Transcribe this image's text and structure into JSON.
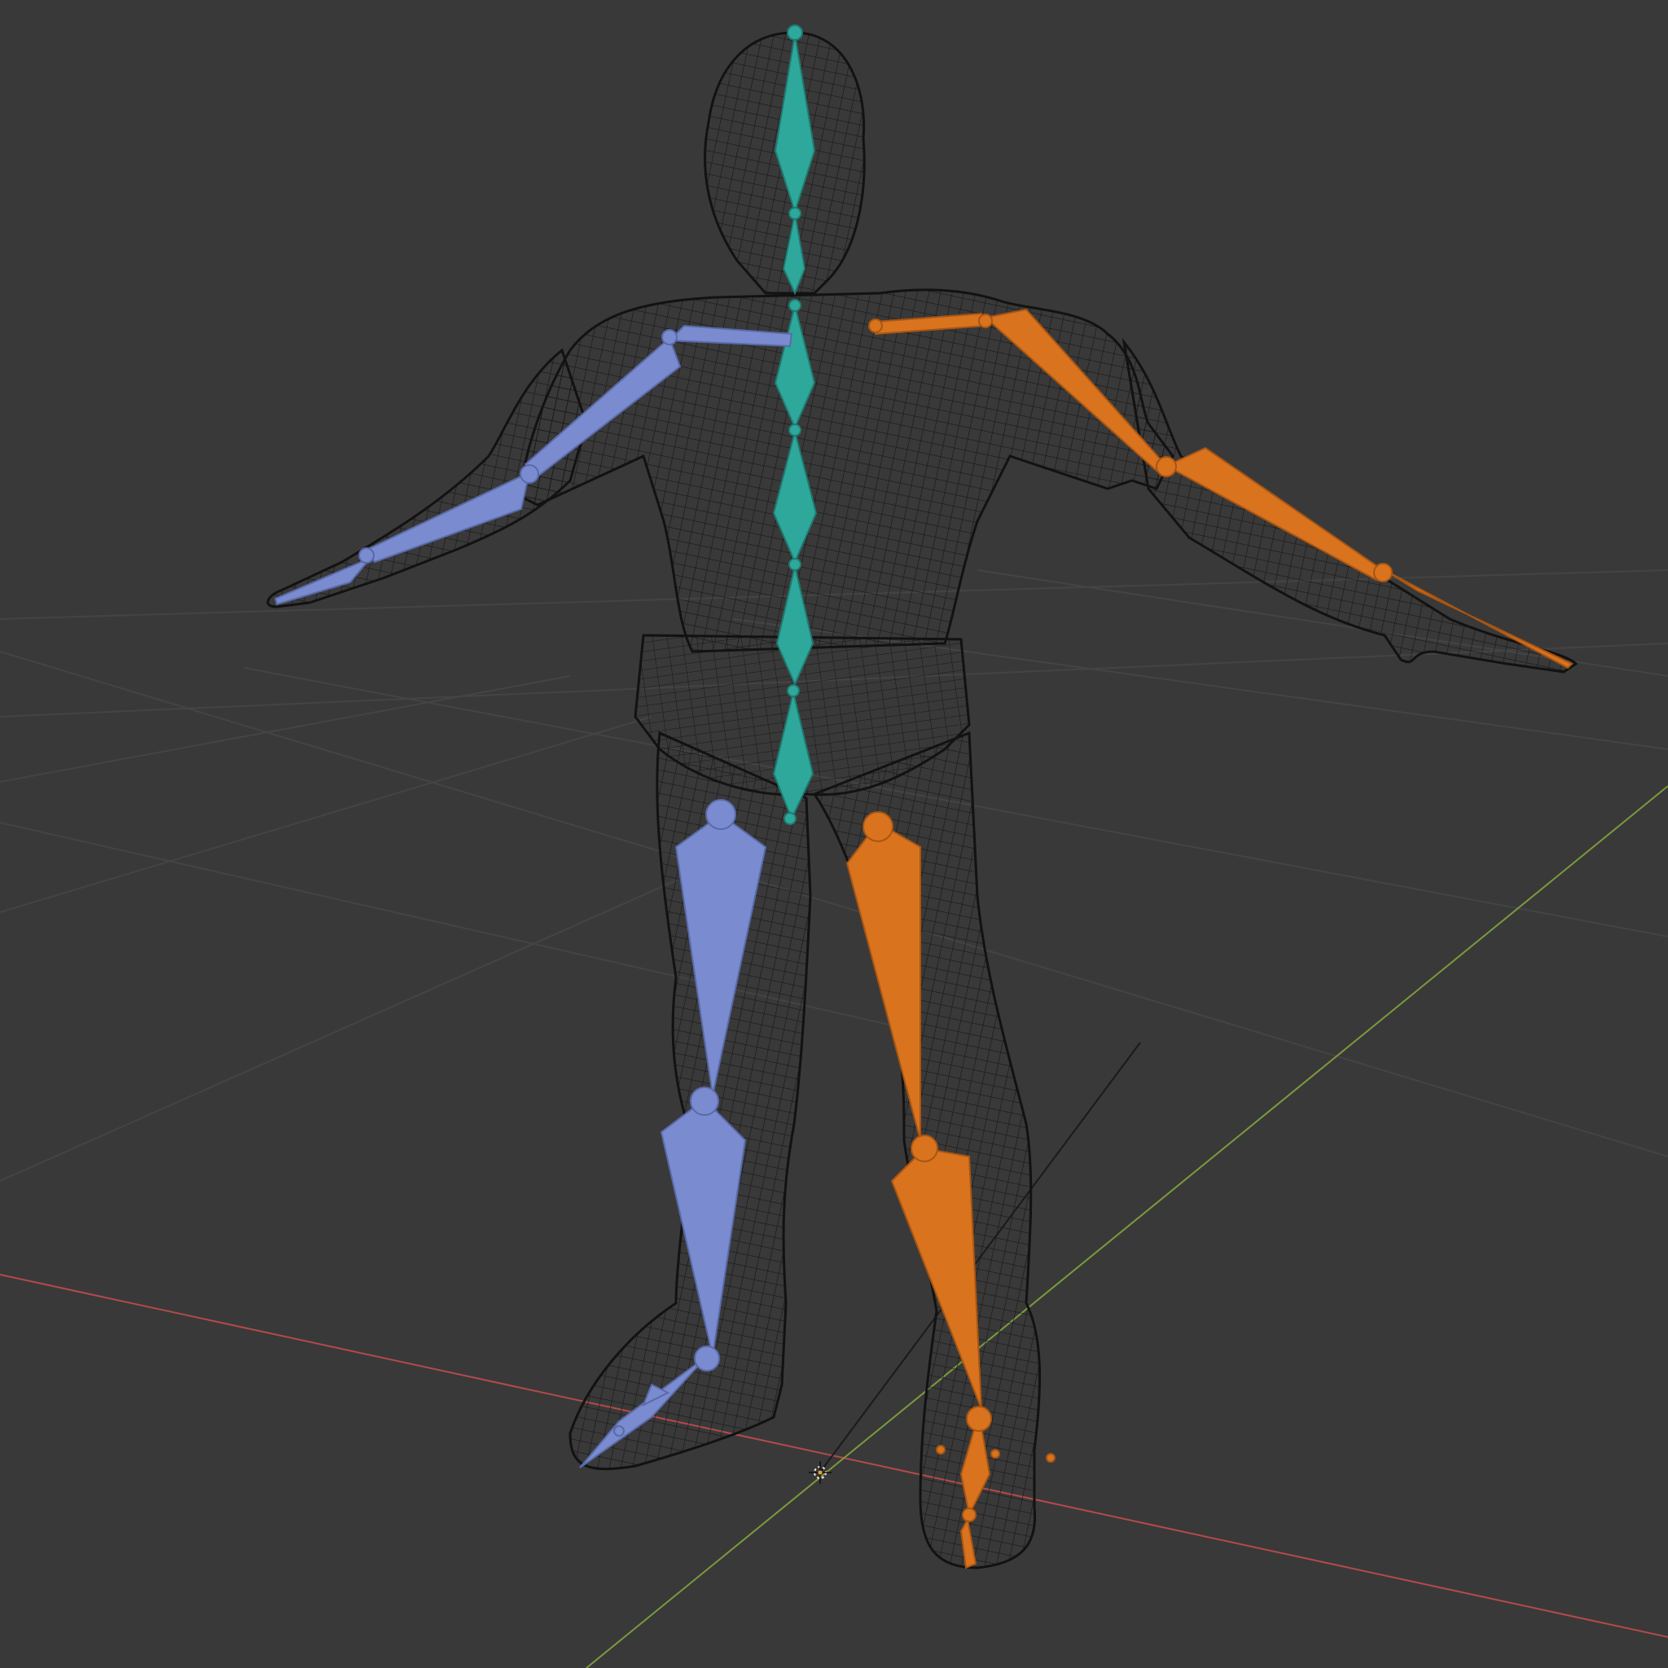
{
  "viewport": {
    "background": "#393939",
    "grid_color": "#454545",
    "x_axis_color": "#b44a4a",
    "y_axis_color": "#7c9a3c"
  },
  "armature": {
    "spine_color": "#2fa89c",
    "left_side_color": "#7a8bd0",
    "right_side_color": "#d9731e",
    "mesh_wire_color": "#111111"
  },
  "icons": {
    "origin": "3d-cursor-icon"
  }
}
